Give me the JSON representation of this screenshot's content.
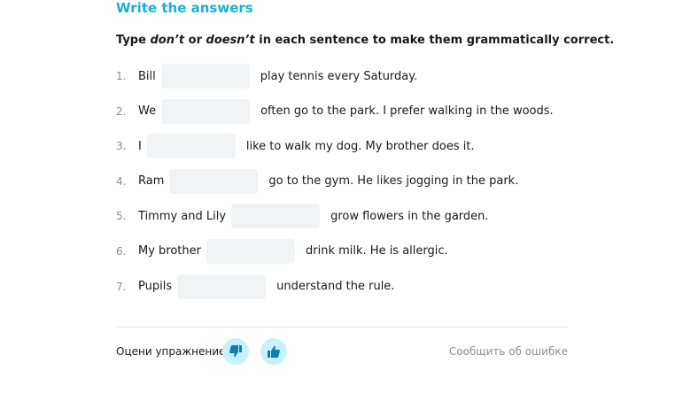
{
  "title": "Write the answers",
  "instruction": {
    "prefix": "Type ",
    "word1": "don’t",
    "middle": " or ",
    "word2": "doesn’t",
    "suffix": " in each sentence to make them grammatically correct."
  },
  "items": [
    {
      "num": "1.",
      "before": "Bill",
      "after": "play tennis every Saturday.",
      "value": ""
    },
    {
      "num": "2.",
      "before": "We",
      "after": "often go to the park. I prefer walking in the woods.",
      "value": ""
    },
    {
      "num": "3.",
      "before": "I",
      "after": "like to walk my dog. My brother does it.",
      "value": ""
    },
    {
      "num": "4.",
      "before": "Ram",
      "after": "go to the gym. He likes jogging in the park.",
      "value": ""
    },
    {
      "num": "5.",
      "before": "Timmy and Lily",
      "after": "grow flowers in the garden.",
      "value": ""
    },
    {
      "num": "6.",
      "before": "My brother",
      "after": "drink milk. He is allergic.",
      "value": ""
    },
    {
      "num": "7.",
      "before": "Pupils",
      "after": "understand the rule.",
      "value": ""
    }
  ],
  "footer": {
    "rate_label": "Оцени упражнение",
    "dislike_icon": "thumbs-down-icon",
    "like_icon": "thumbs-up-icon",
    "report_label": "Сообщить об ошибке"
  },
  "colors": {
    "accent": "#1ab0d6",
    "input_bg": "#f1f4f6",
    "thumb_bg": "#c9f1fb",
    "icon": "#0a7fb0"
  }
}
